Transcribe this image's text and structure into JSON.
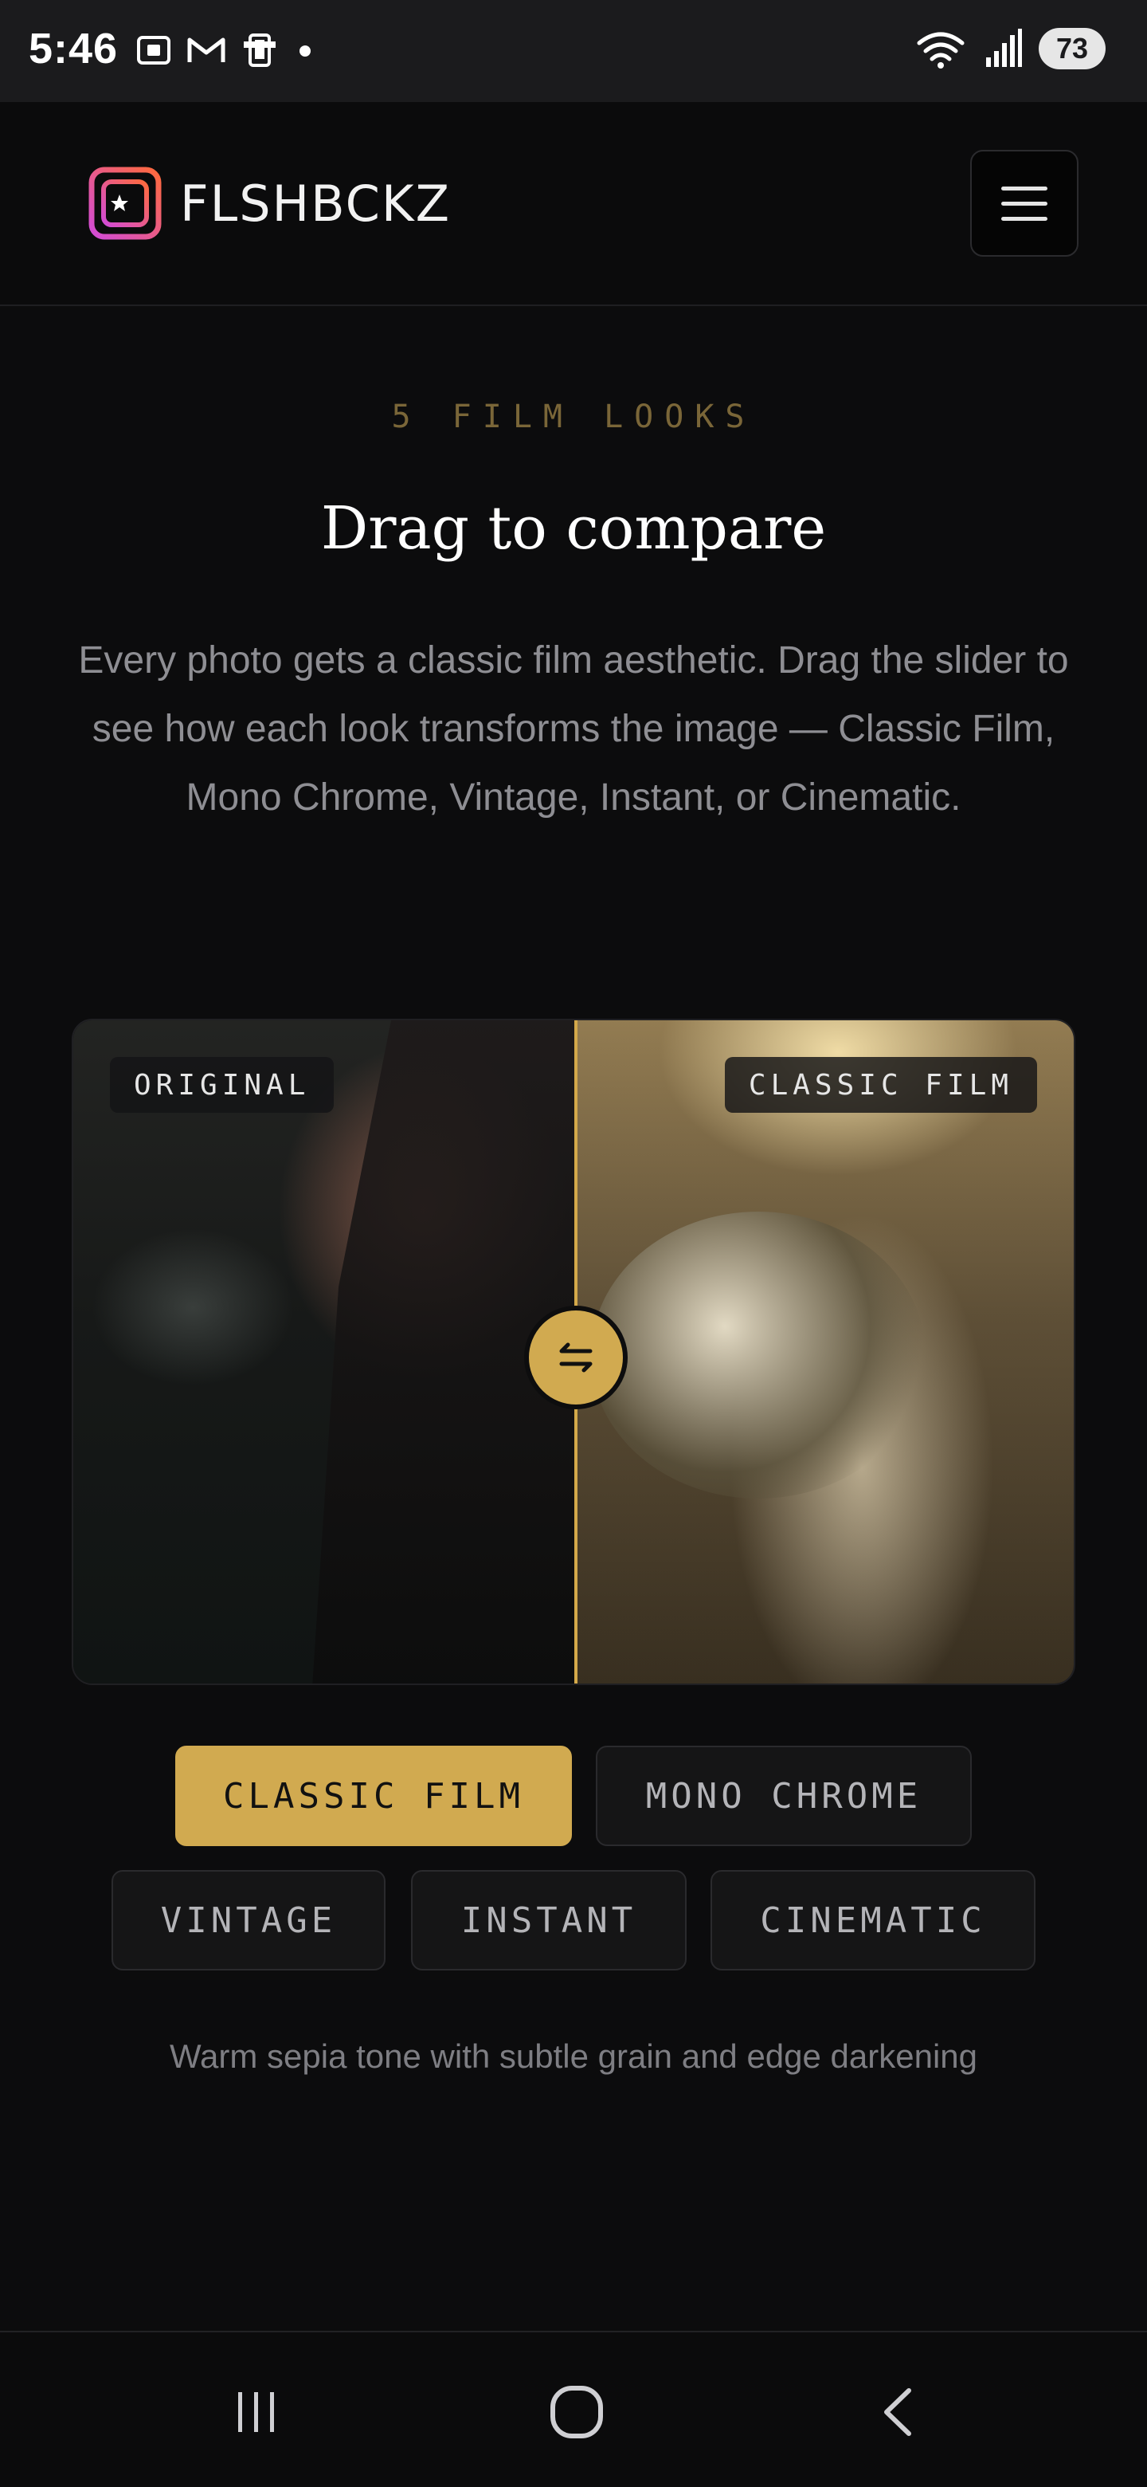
{
  "status_bar": {
    "time": "5:46",
    "battery": "73",
    "icons_left": [
      "screenshot-icon",
      "gmail-icon",
      "phone-icon",
      "dot-icon"
    ],
    "icons_right": [
      "wifi-icon",
      "signal-icon",
      "battery-icon"
    ]
  },
  "header": {
    "logo_text": "FLSHBCKZ",
    "menu_icon": "hamburger-icon"
  },
  "intro": {
    "eyebrow": "5 FILM LOOKS",
    "headline": "Drag to compare",
    "description": "Every photo gets a classic film aesthetic. Drag the slider to see how each look transforms the image — Classic Film, Mono Chrome, Vintage, Instant, or Cinematic."
  },
  "compare": {
    "left_label": "ORIGINAL",
    "right_label": "CLASSIC FILM",
    "handle_icon": "swap-arrows-icon",
    "slider_position": 0.5,
    "accent_color": "#d1aa50"
  },
  "looks": [
    {
      "label": "CLASSIC FILM",
      "active": true
    },
    {
      "label": "MONO CHROME",
      "active": false
    },
    {
      "label": "VINTAGE",
      "active": false
    },
    {
      "label": "INSTANT",
      "active": false
    },
    {
      "label": "CINEMATIC",
      "active": false
    }
  ],
  "caption": "Warm sepia tone with subtle grain and edge darkening",
  "nav": {
    "recents_icon": "recents-icon",
    "home_icon": "home-icon",
    "back_icon": "back-icon"
  }
}
